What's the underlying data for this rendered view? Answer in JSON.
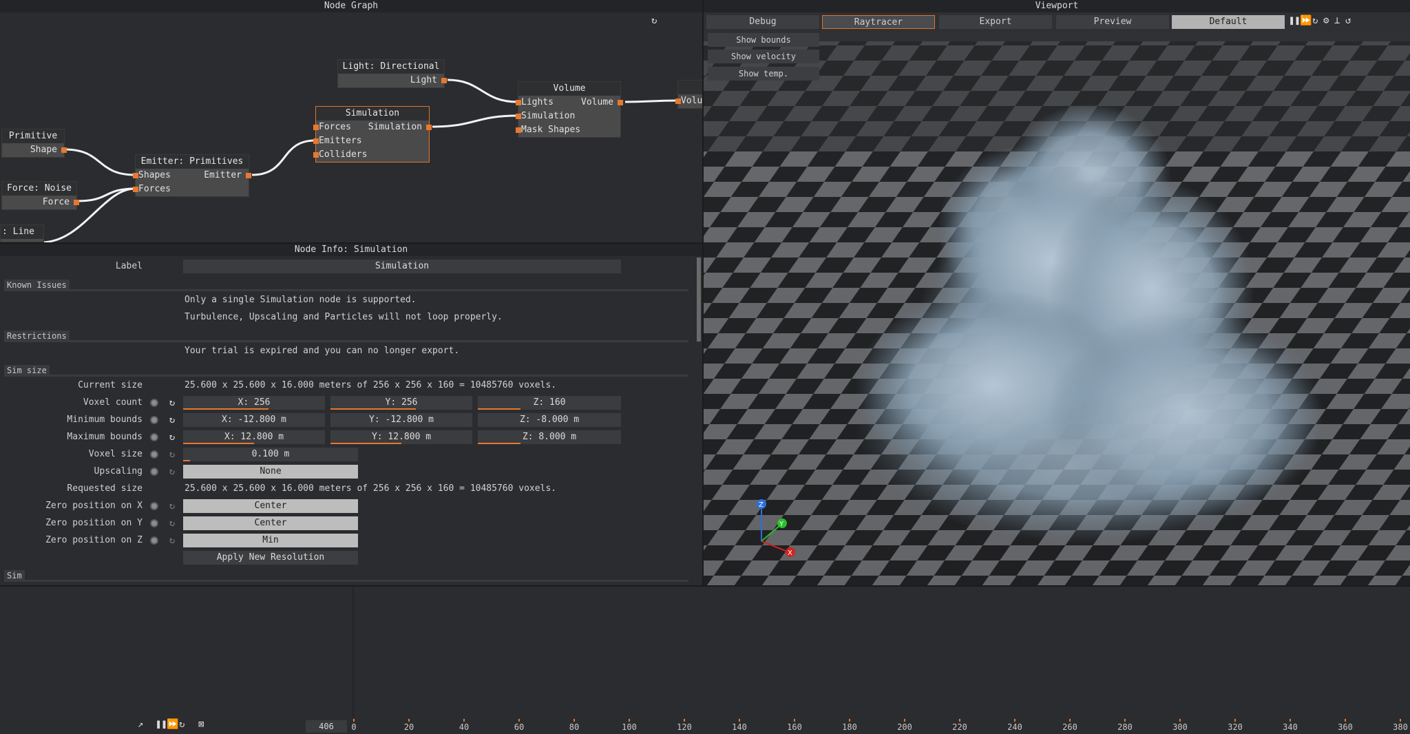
{
  "node_graph": {
    "title": "Node Graph",
    "refresh_icon": "refresh-icon",
    "nodes": {
      "primitive": {
        "title": "Primitive",
        "out": "Shape"
      },
      "force_noise": {
        "title": "Force: Noise",
        "out": "Force"
      },
      "force_line": {
        "title": ": Line"
      },
      "emitter": {
        "title": "Emitter: Primitives",
        "in": [
          "Shapes",
          "Forces"
        ],
        "out": "Emitter"
      },
      "simulation": {
        "title": "Simulation",
        "in": [
          "Forces",
          "Emitters",
          "Colliders"
        ],
        "out": "Simulation"
      },
      "light": {
        "title": "Light: Directional",
        "out": "Light"
      },
      "volume": {
        "title": "Volume",
        "in": [
          "Lights",
          "Simulation",
          "Mask Shapes"
        ],
        "out": "Volume"
      },
      "volume_cut": {
        "title": "",
        "in": "Volu"
      }
    }
  },
  "node_info": {
    "title": "Node Info: Simulation",
    "label_caption": "Label",
    "label_value": "Simulation",
    "known_issues": {
      "heading": "Known Issues",
      "lines": [
        "Only a single Simulation node is supported.",
        "Turbulence, Upscaling and Particles will not loop properly."
      ]
    },
    "restrictions": {
      "heading": "Restrictions",
      "lines": [
        "Your trial is expired and you can no longer export."
      ]
    },
    "sim_size": {
      "heading": "Sim size",
      "current_size_label": "Current size",
      "current_size_value": "25.600 x 25.600 x 16.000 meters of 256 x 256 x 160 = 10485760 voxels.",
      "voxel_count_label": "Voxel count",
      "voxel_count": {
        "x": "X: 256",
        "y": "Y: 256",
        "z": "Z: 160",
        "x_fill": 0.6,
        "y_fill": 0.6,
        "z_fill": 0.3
      },
      "min_bounds_label": "Minimum bounds",
      "min_bounds": {
        "x": "X: -12.800 m",
        "y": "Y: -12.800 m",
        "z": "Z: -8.000 m",
        "x_fill": 0.0,
        "y_fill": 0.0,
        "z_fill": 0.0
      },
      "max_bounds_label": "Maximum bounds",
      "max_bounds": {
        "x": "X: 12.800 m",
        "y": "Y: 12.800 m",
        "z": "Z: 8.000 m",
        "x_fill": 0.5,
        "y_fill": 0.5,
        "z_fill": 0.3
      },
      "voxel_size_label": "Voxel size",
      "voxel_size_value": "0.100 m",
      "voxel_size_fill": 0.04,
      "upscaling_label": "Upscaling",
      "upscaling_value": "None",
      "requested_size_label": "Requested size",
      "requested_size_value": "25.600 x 25.600 x 16.000 meters of 256 x 256 x 160 = 10485760 voxels.",
      "zero_x_label": "Zero position on X",
      "zero_x_value": "Center",
      "zero_y_label": "Zero position on Y",
      "zero_y_value": "Center",
      "zero_z_label": "Zero position on Z",
      "zero_z_value": "Min",
      "apply_button": "Apply New Resolution"
    },
    "sim_heading": "Sim"
  },
  "viewport": {
    "title": "Viewport",
    "tabs": [
      "Debug",
      "Raytracer",
      "Export",
      "Preview",
      "Default"
    ],
    "active_tab": "Raytracer",
    "side_buttons": [
      "Show bounds",
      "Show velocity",
      "Show temp."
    ],
    "gizmo": {
      "x": "X",
      "y": "Y",
      "z": "Z"
    },
    "colors": {
      "x": "#d32222",
      "y": "#2bbf2b",
      "z": "#2a6fe0"
    }
  },
  "timeline": {
    "frame": "406",
    "ticks": [
      "0",
      "20",
      "40",
      "60",
      "80",
      "100",
      "120",
      "140",
      "160",
      "180",
      "200",
      "220",
      "240",
      "260",
      "280",
      "300",
      "320",
      "340",
      "360",
      "380"
    ]
  },
  "colors": {
    "accent": "#e8782f",
    "background": "#2b2c2f"
  }
}
